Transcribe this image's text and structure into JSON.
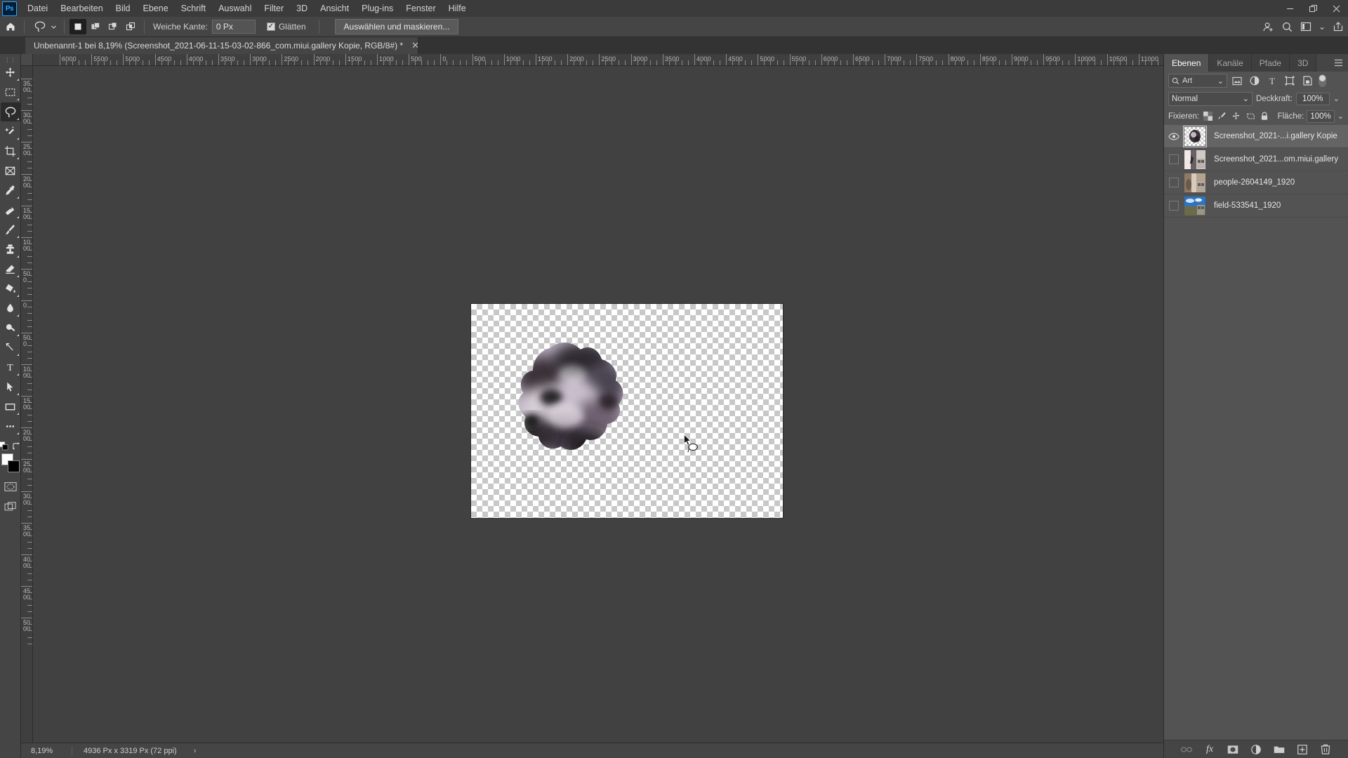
{
  "app": {
    "name": "Ps",
    "logo_color": "#31a8ff"
  },
  "menubar": {
    "items": [
      {
        "label": "Datei"
      },
      {
        "label": "Bearbeiten"
      },
      {
        "label": "Bild"
      },
      {
        "label": "Ebene"
      },
      {
        "label": "Schrift"
      },
      {
        "label": "Auswahl"
      },
      {
        "label": "Filter"
      },
      {
        "label": "3D"
      },
      {
        "label": "Ansicht"
      },
      {
        "label": "Plug-ins"
      },
      {
        "label": "Fenster"
      },
      {
        "label": "Hilfe"
      }
    ],
    "window_controls": {
      "minimize": "—",
      "maximize": "❐",
      "close": "✕"
    }
  },
  "options_bar": {
    "home_icon": "home-icon",
    "tool_icon": "lasso-tool-icon",
    "selection_modes": [
      {
        "name": "new-selection",
        "active": true
      },
      {
        "name": "add-to-selection",
        "active": false
      },
      {
        "name": "subtract-from-selection",
        "active": false
      },
      {
        "name": "intersect-selection",
        "active": false
      }
    ],
    "feather_label": "Weiche Kante:",
    "feather_value": "0 Px",
    "antialias_label": "Glätten",
    "antialias_checked": true,
    "select_mask_button": "Auswählen und maskieren...",
    "right_icons": [
      "user-add-icon",
      "search-icon",
      "workspace-icon",
      "chevron-down-icon",
      "share-export-icon"
    ]
  },
  "document_tab": {
    "title": "Unbenannt-1 bei 8,19% (Screenshot_2021-06-11-15-03-02-866_com.miui.gallery Kopie, RGB/8#) *",
    "close": "✕"
  },
  "toolbar": {
    "tools": [
      {
        "name": "move-tool",
        "icon": "move-icon",
        "active": false,
        "has_flyout": true
      },
      {
        "name": "marquee-tool",
        "icon": "rectangular-marquee-icon",
        "active": false,
        "has_flyout": true
      },
      {
        "name": "lasso-tool",
        "icon": "lasso-icon",
        "active": true,
        "has_flyout": true
      },
      {
        "name": "object-selection-tool",
        "icon": "magic-wand-icon",
        "active": false,
        "has_flyout": true
      },
      {
        "name": "crop-tool",
        "icon": "crop-icon",
        "active": false,
        "has_flyout": true
      },
      {
        "name": "frame-tool",
        "icon": "frame-icon",
        "active": false,
        "has_flyout": false
      },
      {
        "name": "eyedropper-tool",
        "icon": "eyedropper-icon",
        "active": false,
        "has_flyout": true
      },
      {
        "name": "healing-brush-tool",
        "icon": "healing-brush-icon",
        "active": false,
        "has_flyout": true
      },
      {
        "name": "brush-tool",
        "icon": "brush-icon",
        "active": false,
        "has_flyout": true
      },
      {
        "name": "clone-stamp-tool",
        "icon": "clone-stamp-icon",
        "active": false,
        "has_flyout": true
      },
      {
        "name": "eraser-tool",
        "icon": "eraser-icon",
        "active": false,
        "has_flyout": true
      },
      {
        "name": "gradient-tool",
        "icon": "paint-bucket-icon",
        "active": false,
        "has_flyout": true
      },
      {
        "name": "blur-tool",
        "icon": "blur-drop-icon",
        "active": false,
        "has_flyout": true
      },
      {
        "name": "dodge-tool",
        "icon": "dodge-icon",
        "active": false,
        "has_flyout": true
      },
      {
        "name": "pen-tool",
        "icon": "pen-icon",
        "active": false,
        "has_flyout": true
      },
      {
        "name": "type-tool",
        "icon": "type-t-icon",
        "active": false,
        "has_flyout": true
      },
      {
        "name": "path-selection-tool",
        "icon": "path-arrow-icon",
        "active": false,
        "has_flyout": true
      },
      {
        "name": "shape-tool",
        "icon": "rectangle-shape-icon",
        "active": false,
        "has_flyout": true
      },
      {
        "name": "edit-toolbar",
        "icon": "ellipsis-icon",
        "active": false,
        "has_flyout": true
      }
    ],
    "swatch_controls": {
      "default_icon": "default-colors-icon",
      "swap_icon": "swap-colors-icon"
    },
    "foreground_color": "#ffffff",
    "background_color": "#000000",
    "quick_mask_icon": "quick-mask-icon",
    "screen_mode_icon": "screen-mode-icon"
  },
  "ruler": {
    "unit": "Px",
    "h_labels": [
      "6000",
      "5500",
      "5000",
      "4500",
      "4000",
      "3500",
      "3000",
      "2500",
      "2000",
      "1500",
      "1000",
      "500",
      "0",
      "500",
      "1000",
      "1500",
      "2000",
      "2500",
      "3000",
      "3500",
      "4000",
      "4500",
      "5000",
      "5500",
      "6000",
      "6500",
      "7000",
      "7500",
      "8000",
      "8500",
      "9000",
      "9500",
      "10000",
      "10500",
      "11000"
    ],
    "v_labels": [
      "3500",
      "3000",
      "2500",
      "2000",
      "1500",
      "1000",
      "500",
      "0",
      "500",
      "1000",
      "1500",
      "2000",
      "2500",
      "3000",
      "3500",
      "4000",
      "4500",
      "5000"
    ]
  },
  "canvas": {
    "artboard_label": "transparent-artboard",
    "content_icon": "smoke-cutout-image",
    "cursor": "lasso-cursor"
  },
  "status_bar": {
    "zoom": "8,19%",
    "doc_info": "4936 Px x 3319 Px (72 ppi)",
    "expand": "›"
  },
  "right_dock": {
    "tabs": [
      {
        "label": "Ebenen",
        "active": true
      },
      {
        "label": "Kanäle",
        "active": false
      },
      {
        "label": "Pfade",
        "active": false
      },
      {
        "label": "3D",
        "active": false
      }
    ],
    "panel_menu_icon": "panel-menu-icon",
    "filter": {
      "search_icon": "search-icon",
      "kind_label": "Art",
      "chevron": "⌄",
      "icons": [
        "filter-pixel-icon",
        "filter-adjustment-icon",
        "filter-type-icon",
        "filter-shape-icon",
        "filter-smart-object-icon"
      ],
      "toggle_name": "filter-toggle"
    },
    "blend": {
      "mode": "Normal",
      "chevron": "⌄",
      "opacity_label": "Deckkraft:",
      "opacity_value": "100%"
    },
    "lock": {
      "label": "Fixieren:",
      "icons": [
        "lock-transparency-icon",
        "lock-image-icon",
        "lock-position-icon",
        "lock-artboard-icon",
        "lock-all-icon"
      ],
      "fill_label": "Fläche:",
      "fill_value": "100%"
    },
    "layers": [
      {
        "name": "Screenshot_2021-...i.gallery Kopie",
        "visible": true,
        "selected": true,
        "thumb": "smoke-cutout-thumb",
        "linked": false
      },
      {
        "name": "Screenshot_2021...om.miui.gallery",
        "visible": false,
        "selected": false,
        "thumb": "screenshot-thumb",
        "linked": true
      },
      {
        "name": "people-2604149_1920",
        "visible": false,
        "selected": false,
        "thumb": "people-thumb",
        "linked": true
      },
      {
        "name": "field-533541_1920",
        "visible": false,
        "selected": false,
        "thumb": "field-thumb",
        "linked": true
      }
    ],
    "footer_icons": [
      {
        "name": "link-layers-icon",
        "glyph": "⚭",
        "disabled": true
      },
      {
        "name": "layer-styles-fx-icon",
        "glyph": "fx",
        "disabled": false
      },
      {
        "name": "add-layer-mask-icon",
        "glyph": "",
        "disabled": false
      },
      {
        "name": "new-adjustment-layer-icon",
        "glyph": "",
        "disabled": false
      },
      {
        "name": "new-group-icon",
        "glyph": "",
        "disabled": false
      },
      {
        "name": "new-layer-icon",
        "glyph": "",
        "disabled": false
      },
      {
        "name": "delete-layer-icon",
        "glyph": "",
        "disabled": false
      }
    ]
  }
}
